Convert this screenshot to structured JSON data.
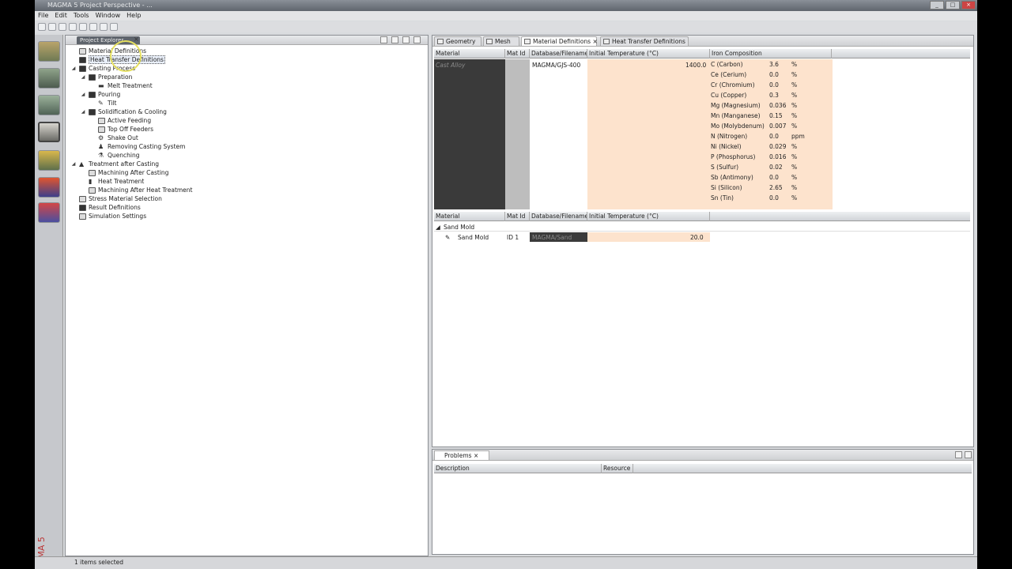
{
  "window": {
    "title": "MAGMA 5 Project Perspective - ..."
  },
  "menubar": [
    "File",
    "Edit",
    "Tools",
    "Window",
    "Help"
  ],
  "tree": {
    "tab_label": "Project Explorer",
    "items": [
      {
        "label": "Material Definitions",
        "level": 0
      },
      {
        "label": "Heat Transfer Definitions",
        "level": 0,
        "selected": true
      },
      {
        "label": "Casting Process",
        "level": 0
      },
      {
        "label": "Preparation",
        "level": 1
      },
      {
        "label": "Melt Treatment",
        "level": 2
      },
      {
        "label": "Pouring",
        "level": 1
      },
      {
        "label": "Tilt",
        "level": 2
      },
      {
        "label": "Solidification & Cooling",
        "level": 1
      },
      {
        "label": "Active Feeding",
        "level": 2
      },
      {
        "label": "Top Off Feeders",
        "level": 2
      },
      {
        "label": "Shake Out",
        "level": 2
      },
      {
        "label": "Removing Casting System",
        "level": 2
      },
      {
        "label": "Quenching",
        "level": 2
      },
      {
        "label": "Treatment after Casting",
        "level": 0
      },
      {
        "label": "Machining After Casting",
        "level": 1
      },
      {
        "label": "Heat Treatment",
        "level": 1
      },
      {
        "label": "Machining After Heat Treatment",
        "level": 1
      },
      {
        "label": "Stress Material Selection",
        "level": 0
      },
      {
        "label": "Result Definitions",
        "level": 0
      },
      {
        "label": "Simulation Settings",
        "level": 0
      }
    ]
  },
  "editor": {
    "tabs": [
      "Geometry",
      "Mesh",
      "Material Definitions",
      "Heat Transfer Definitions"
    ],
    "grid1": {
      "headers": [
        "Material",
        "Mat Id",
        "Database/Filename",
        "Initial Temperature (°C)",
        "Iron Composition"
      ],
      "row": {
        "material": "Cast Alloy",
        "database": "MAGMA/GJS-400",
        "temperature": "1400.0"
      },
      "composition": [
        {
          "element": "C (Carbon)",
          "value": "3.6",
          "unit": "%"
        },
        {
          "element": "Ce (Cerium)",
          "value": "0.0",
          "unit": "%"
        },
        {
          "element": "Cr (Chromium)",
          "value": "0.0",
          "unit": "%"
        },
        {
          "element": "Cu (Copper)",
          "value": "0.3",
          "unit": "%"
        },
        {
          "element": "Mg (Magnesium)",
          "value": "0.036",
          "unit": "%"
        },
        {
          "element": "Mn (Manganese)",
          "value": "0.15",
          "unit": "%"
        },
        {
          "element": "Mo (Molybdenum)",
          "value": "0.007",
          "unit": "%"
        },
        {
          "element": "N (Nitrogen)",
          "value": "0.0",
          "unit": "ppm"
        },
        {
          "element": "Ni (Nickel)",
          "value": "0.029",
          "unit": "%"
        },
        {
          "element": "P (Phosphorus)",
          "value": "0.016",
          "unit": "%"
        },
        {
          "element": "S (Sulfur)",
          "value": "0.02",
          "unit": "%"
        },
        {
          "element": "Sb (Antimony)",
          "value": "0.0",
          "unit": "%"
        },
        {
          "element": "Si (Silicon)",
          "value": "2.65",
          "unit": "%"
        },
        {
          "element": "Sn (Tin)",
          "value": "0.0",
          "unit": "%"
        }
      ]
    },
    "grid2": {
      "headers": [
        "Material",
        "Mat Id",
        "Database/Filename",
        "Initial Temperature (°C)"
      ],
      "group": "Sand Mold",
      "row": {
        "material": "Sand Mold",
        "matid": "ID 1",
        "database": "MAGMA/Sand",
        "temperature": "20.0"
      }
    }
  },
  "problems": {
    "tab_label": "Problems",
    "headers": [
      "Description",
      "Resource"
    ]
  },
  "status": {
    "text": "1 items selected"
  }
}
